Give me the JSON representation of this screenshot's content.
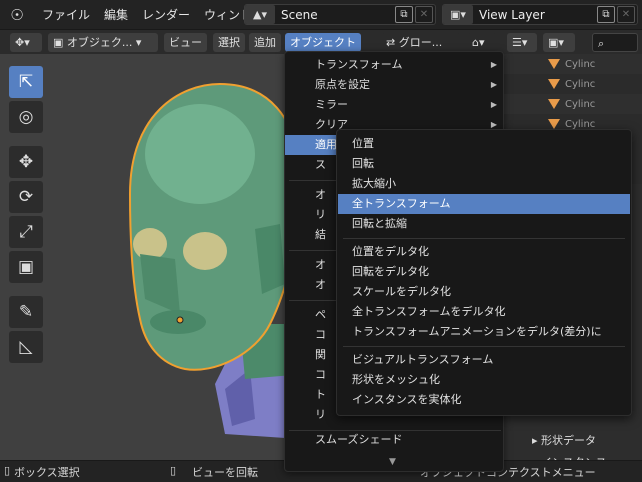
{
  "topbar": {
    "menus": [
      "ファイル",
      "編集",
      "レンダー",
      "ウィンド"
    ],
    "scene_name": "Scene",
    "view_layer": "View Layer"
  },
  "header": {
    "mode": "オブジェク...",
    "view": "ビュー",
    "select": "選択",
    "add": "追加",
    "object": "オブジェクト",
    "transform_orientation": "グロー..."
  },
  "outliner": {
    "items": [
      "Cylinc",
      "Cylinc",
      "Cylinc",
      "Cylinc"
    ]
  },
  "properties": {
    "shape_data": "形状データ",
    "instance": "インスタンス"
  },
  "object_menu": {
    "items": [
      {
        "label": "トランスフォーム",
        "submenu": true
      },
      {
        "label": "原点を設定",
        "submenu": true
      },
      {
        "label": "ミラー",
        "submenu": true
      },
      {
        "label": "クリア",
        "submenu": true
      },
      {
        "label": "適用",
        "submenu": true,
        "highlighted": true
      },
      {
        "label": "ス",
        "submenu": true
      },
      {
        "label": "オ",
        "submenu": false
      },
      {
        "label": "リ",
        "submenu": false
      },
      {
        "label": "結",
        "submenu": false
      },
      {
        "label": "オ",
        "submenu": false
      },
      {
        "label": "オ",
        "submenu": false
      },
      {
        "label": "ペ",
        "submenu": false
      },
      {
        "label": "コ",
        "submenu": false
      },
      {
        "label": "関",
        "submenu": false
      },
      {
        "label": "コ",
        "submenu": false
      },
      {
        "label": "ト",
        "submenu": false
      },
      {
        "label": "リ",
        "submenu": false
      }
    ],
    "smooth_shade": "スムーズシェード",
    "more_indicator": "▼"
  },
  "apply_submenu": {
    "items": [
      "位置",
      "回転",
      "拡大縮小",
      "全トランスフォーム",
      "回転と拡縮",
      "位置をデルタ化",
      "回転をデルタ化",
      "スケールをデルタ化",
      "全トランスフォームをデルタ化",
      "トランスフォームアニメーションをデルタ(差分)に",
      "ビジュアルトランスフォーム",
      "形状をメッシュ化",
      "インスタンスを実体化"
    ],
    "highlighted": "全トランスフォーム"
  },
  "statusbar": {
    "box_select": "ボックス選択",
    "rotate_view": "ビューを回転",
    "context_menu": "オブジェクトコンテクストメニュー"
  },
  "colors": {
    "accent": "#5680c2",
    "viewport_bg": "#404040",
    "outline": "#f0a030",
    "mesh": "#5e9a7a",
    "cylinder_icon": "#e89b4a"
  }
}
